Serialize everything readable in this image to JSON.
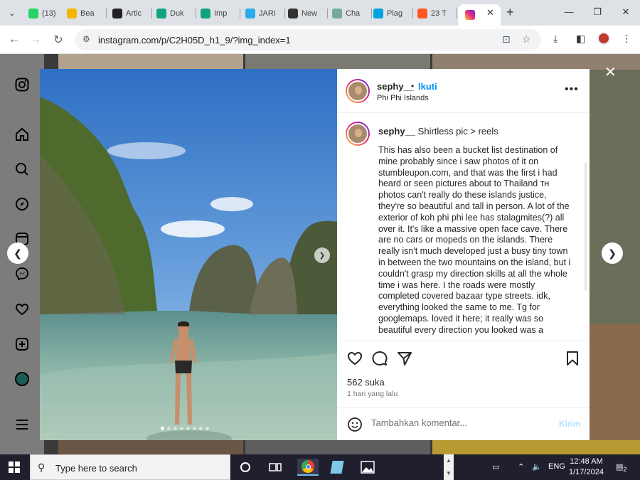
{
  "browser": {
    "tabs": [
      {
        "label": "(13)",
        "icon": "whatsapp-icon",
        "color": "#25d366"
      },
      {
        "label": "Bea",
        "icon": "bookmark-icon",
        "color": "#f4b400"
      },
      {
        "label": "Artic",
        "icon": "ko-icon",
        "color": "#222222"
      },
      {
        "label": "Duk",
        "icon": "duk-icon",
        "color": "#10a37f"
      },
      {
        "label": "Imp",
        "icon": "imp-icon",
        "color": "#10a37f"
      },
      {
        "label": "JARI",
        "icon": "telegram-icon",
        "color": "#2aabee"
      },
      {
        "label": "New",
        "icon": "github-icon",
        "color": "#333333"
      },
      {
        "label": "Cha",
        "icon": "chatgpt-icon",
        "color": "#74aa9c"
      },
      {
        "label": "Plag",
        "icon": "plag-icon",
        "color": "#00a3e0"
      },
      {
        "label": "23 T",
        "icon": "six-icon",
        "color": "#ff5722"
      }
    ],
    "active_tab_icon": "instagram-icon",
    "url": "instagram.com/p/C2H05D_h1_9/?img_index=1"
  },
  "post": {
    "username": "sephy__",
    "follow_label": "Ikuti",
    "separator": "•",
    "location": "Phi Phi Islands",
    "caption_title": "Shirtless pic > reels",
    "caption_body": "This has also been a bucket list destination of mine probably since i saw photos of it on stumbleupon.com, and that was the first i had heard or seen pictures about to Thailand ᴛʜ photos can't really do these islands justice, they're so beautiful and tall in person. A lot of the exterior of koh phi phi lee has stalagmites(?) all over it. It's like a massive open face cave. There are no cars or mopeds on the islands. There really isn't much developed just a busy tiny town in between the two mountains on the island, but i couldn't grasp my direction skills at all the whole time i was here. I the roads were mostly completed covered bazaar type streets. idk, everything looked the same to me. Tg for googlemaps. loved it here; it really was so beautiful every direction you looked was a",
    "likes": "562 suka",
    "time_ago": "1 hari yang lalu",
    "comment_placeholder": "Tambahkan komentar...",
    "post_button": "Kirim",
    "carousel_count": 8,
    "carousel_index": 1
  },
  "taskbar": {
    "search_placeholder": "Type here to search",
    "language": "ENG",
    "time": "12:48 AM",
    "date": "1/17/2024",
    "notification_count": "2"
  },
  "colors": {
    "follow_blue": "#0095f6",
    "post_disabled": "#b2dffc",
    "taskbar": "#1f1f2e"
  }
}
